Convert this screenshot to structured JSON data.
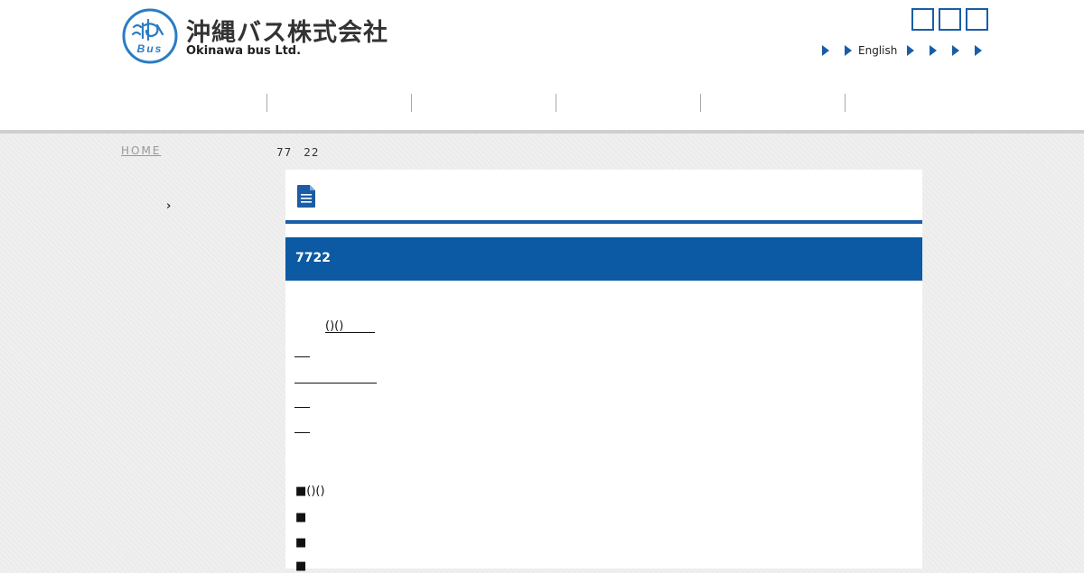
{
  "header": {
    "company_name_ja": "沖縄バス株式会社",
    "company_name_en": "Okinawa bus Ltd.",
    "logo_text": "Bus",
    "english_label": "English",
    "accent_color": "#1a5da6"
  },
  "breadcrumb": {
    "home": "HOME",
    "current": "　　　　　　　　77　22"
  },
  "sidebar": {
    "items": [
      {
        "label": "　　　　　　　　　　　　"
      },
      {
        "label": "　　　　　　　　　　　　　"
      },
      {
        "label": "　　　　　　"
      }
    ]
  },
  "content": {
    "title": "7722",
    "lines": {
      "line1": "()()"
    },
    "square_items": [
      {
        "label": "■()()"
      },
      {
        "label": "■"
      },
      {
        "label": "■"
      },
      {
        "label": "■"
      }
    ]
  }
}
